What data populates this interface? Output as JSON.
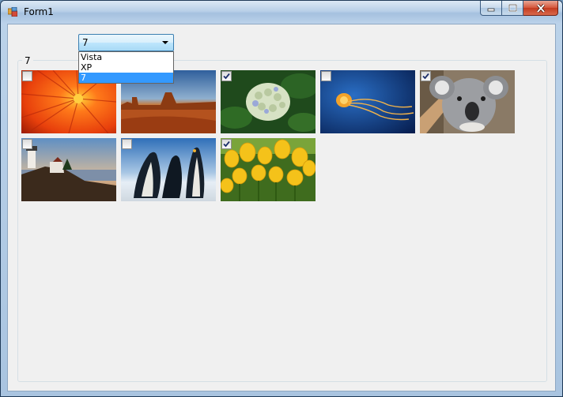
{
  "window": {
    "title": "Form1",
    "icon": "winforms-app-icon"
  },
  "titlebar_buttons": [
    "minimize-icon",
    "maximize-icon",
    "close-icon"
  ],
  "combo": {
    "value": "7",
    "options": [
      "Vista",
      "XP",
      "7"
    ],
    "selected_index": 2
  },
  "group": {
    "caption": "7"
  },
  "thumbnails": [
    {
      "name": "chrysanthemum",
      "checked": false
    },
    {
      "name": "desert",
      "checked": false
    },
    {
      "name": "hydrangeas",
      "checked": true
    },
    {
      "name": "jellyfish",
      "checked": false
    },
    {
      "name": "koala",
      "checked": true
    },
    {
      "name": "lighthouse",
      "checked": false
    },
    {
      "name": "penguins",
      "checked": false
    },
    {
      "name": "tulips",
      "checked": true
    }
  ],
  "colors": {
    "selection": "#3399ff",
    "client_bg": "#f0f0f0",
    "close_button": "#c33a1f"
  }
}
